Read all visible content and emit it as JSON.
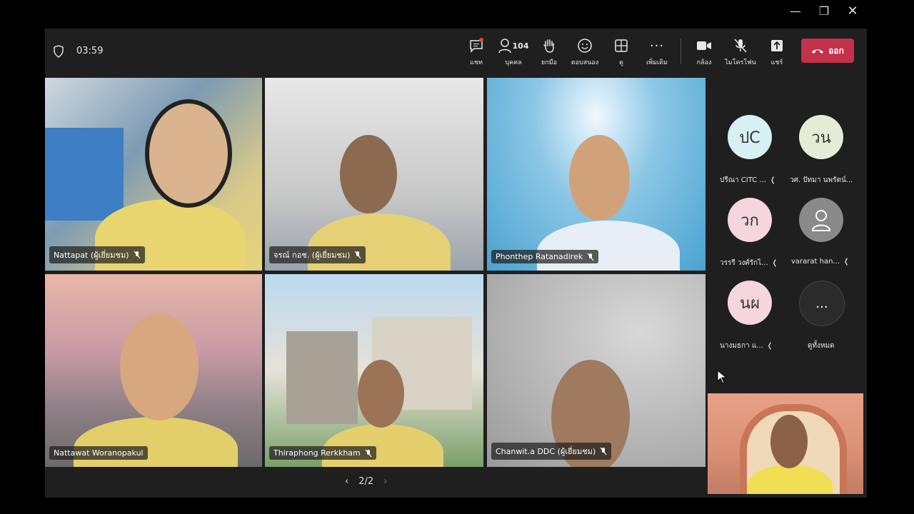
{
  "timer": "03:59",
  "toolbar": {
    "chat": "แชท",
    "people_count": "104",
    "people": "บุคคล",
    "raise_hand": "ยกมือ",
    "react": "ตอบสนอง",
    "view": "ดู",
    "more": "เพิ่มเติม",
    "camera": "กล้อง",
    "mic": "ไมโครโฟน",
    "share": "แชร์",
    "leave": "ออก"
  },
  "tiles": [
    {
      "name": "Nattapat (ผู้เยี่ยมชม)"
    },
    {
      "name": "จรณ์ กอช. (ผู้เยี่ยมชม)"
    },
    {
      "name": "Phonthep Ratanadirek"
    },
    {
      "name": "Nattawat Woranopakul"
    },
    {
      "name": "Thiraphong Rerkkham"
    },
    {
      "name": "Chanwit.a DDC (ผู้เยี่ยมชม)"
    }
  ],
  "participants": [
    {
      "initials": "ปC",
      "name": "ปรีณา CITC ...",
      "color": "#d6f0f3"
    },
    {
      "initials": "วน",
      "name": "วศ. ปัทมา นพรัตน์...",
      "color": "#e5ecd6"
    },
    {
      "initials": "วก",
      "name": "วรรรี วงศ์รักไ...",
      "color": "#f6d6de"
    },
    {
      "initials": "",
      "name": "vararat han...",
      "color": "#8a8a8a"
    },
    {
      "initials": "นผ",
      "name": "นางมธกา แ...",
      "color": "#f6d6de"
    },
    {
      "initials": "...",
      "name": "ดูทั้งหมด",
      "color": "#2b2b2b"
    }
  ],
  "pager": {
    "page": "2/2"
  }
}
